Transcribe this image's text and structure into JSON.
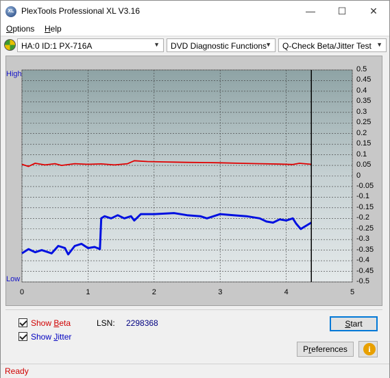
{
  "window": {
    "title": "PlexTools Professional XL V3.16",
    "app_icon_text": "XL",
    "minimize_glyph": "—",
    "maximize_glyph": "☐",
    "close_glyph": "✕"
  },
  "menu": {
    "options": {
      "underline": "O",
      "rest": "ptions"
    },
    "help": {
      "underline": "H",
      "rest": "elp"
    }
  },
  "toolbar": {
    "drive": "HA:0 ID:1  PX-716A",
    "function": "DVD Diagnostic Functions",
    "test": "Q-Check Beta/Jitter Test",
    "arrow": "▼"
  },
  "chart_data": {
    "type": "line",
    "left_axis_labels": {
      "top": "High",
      "bottom": "Low"
    },
    "right_axis": {
      "range": [
        -0.5,
        0.5
      ],
      "ticks": [
        "0.5",
        "0.45",
        "0.4",
        "0.35",
        "0.3",
        "0.25",
        "0.2",
        "0.15",
        "0.1",
        "0.05",
        "0",
        "-0.05",
        "-0.1",
        "-0.15",
        "-0.2",
        "-0.25",
        "-0.3",
        "-0.35",
        "-0.4",
        "-0.45",
        "-0.5"
      ]
    },
    "x_axis": {
      "range": [
        0,
        5
      ],
      "ticks": [
        "0",
        "1",
        "2",
        "3",
        "4",
        "5"
      ]
    },
    "marker_x": 4.38,
    "series": [
      {
        "id": "beta",
        "color": "#e00000",
        "points": [
          [
            0,
            0.055
          ],
          [
            0.1,
            0.045
          ],
          [
            0.2,
            0.06
          ],
          [
            0.35,
            0.052
          ],
          [
            0.5,
            0.058
          ],
          [
            0.6,
            0.05
          ],
          [
            0.8,
            0.058
          ],
          [
            1.0,
            0.055
          ],
          [
            1.2,
            0.057
          ],
          [
            1.4,
            0.052
          ],
          [
            1.6,
            0.058
          ],
          [
            1.7,
            0.072
          ],
          [
            1.9,
            0.068
          ],
          [
            2.2,
            0.066
          ],
          [
            2.5,
            0.064
          ],
          [
            2.8,
            0.063
          ],
          [
            3.0,
            0.062
          ],
          [
            3.3,
            0.06
          ],
          [
            3.6,
            0.058
          ],
          [
            3.9,
            0.056
          ],
          [
            4.1,
            0.054
          ],
          [
            4.2,
            0.06
          ],
          [
            4.38,
            0.055
          ]
        ]
      },
      {
        "id": "jitter",
        "color": "#0010e0",
        "points": [
          [
            0,
            -0.365
          ],
          [
            0.1,
            -0.345
          ],
          [
            0.2,
            -0.36
          ],
          [
            0.3,
            -0.35
          ],
          [
            0.45,
            -0.365
          ],
          [
            0.55,
            -0.33
          ],
          [
            0.65,
            -0.34
          ],
          [
            0.7,
            -0.37
          ],
          [
            0.8,
            -0.33
          ],
          [
            0.9,
            -0.32
          ],
          [
            1.0,
            -0.34
          ],
          [
            1.1,
            -0.335
          ],
          [
            1.18,
            -0.345
          ],
          [
            1.2,
            -0.2
          ],
          [
            1.25,
            -0.19
          ],
          [
            1.35,
            -0.2
          ],
          [
            1.45,
            -0.185
          ],
          [
            1.55,
            -0.2
          ],
          [
            1.65,
            -0.19
          ],
          [
            1.7,
            -0.21
          ],
          [
            1.8,
            -0.18
          ],
          [
            2.0,
            -0.18
          ],
          [
            2.3,
            -0.175
          ],
          [
            2.5,
            -0.185
          ],
          [
            2.7,
            -0.19
          ],
          [
            2.8,
            -0.2
          ],
          [
            2.9,
            -0.19
          ],
          [
            3.0,
            -0.18
          ],
          [
            3.2,
            -0.185
          ],
          [
            3.4,
            -0.19
          ],
          [
            3.6,
            -0.2
          ],
          [
            3.7,
            -0.215
          ],
          [
            3.8,
            -0.22
          ],
          [
            3.9,
            -0.205
          ],
          [
            4.0,
            -0.21
          ],
          [
            4.1,
            -0.2
          ],
          [
            4.15,
            -0.225
          ],
          [
            4.22,
            -0.25
          ],
          [
            4.3,
            -0.235
          ],
          [
            4.38,
            -0.22
          ]
        ]
      }
    ]
  },
  "options": {
    "show_beta": {
      "pre": "Show ",
      "underline": "B",
      "post": "eta",
      "checked": true,
      "color": "#d00000"
    },
    "show_jitter": {
      "pre": "Show ",
      "underline": "J",
      "post": "itter",
      "checked": true,
      "color": "#0000c0"
    }
  },
  "lsn": {
    "label": "LSN:",
    "value": "2298368"
  },
  "buttons": {
    "start": {
      "underline": "S",
      "rest": "tart"
    },
    "preferences": {
      "pre": "P",
      "underline": "r",
      "rest": "eferences"
    },
    "info_glyph": "i"
  },
  "status": "Ready"
}
